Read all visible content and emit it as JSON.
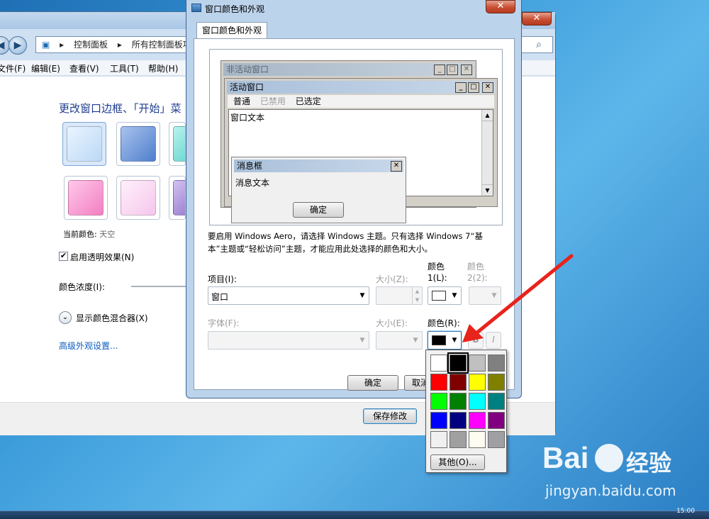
{
  "bg_window": {
    "address_path": [
      "控制面板",
      "所有控制面板项"
    ],
    "menu": [
      "文件(F)",
      "编辑(E)",
      "查看(V)",
      "工具(T)",
      "帮助(H)"
    ],
    "heading": "更改窗口边框、「开始」菜",
    "current_color_label": "当前颜色:",
    "current_color_value": "天空",
    "transparency_label": "启用透明效果(N)",
    "intensity_label": "颜色浓度(I):",
    "mixer_label": "显示颜色混合器(X)",
    "advanced_link": "高级外观设置...",
    "save_button": "保存修改",
    "swatch_colors": [
      "#bcd9f6",
      "#4f7fcc",
      "#57d2c8",
      "#f27fc2",
      "#f5c6ec",
      "#8c6bc8"
    ]
  },
  "dialog": {
    "title": "窗口颜色和外观",
    "close": "✕",
    "tab": "窗口颜色和外观",
    "preview": {
      "inactive_title": "非活动窗口",
      "active_title": "活动窗口",
      "menu_normal": "普通",
      "menu_disabled": "已禁用",
      "menu_selected": "已选定",
      "window_text": "窗口文本",
      "msgbox_title": "消息框",
      "msgbox_text": "消息文本",
      "msgbox_ok": "确定"
    },
    "info_line1": "要启用 Windows Aero，请选择 Windows 主题。只有选择 Windows 7“基",
    "info_line2": "本”主题或“轻松访问”主题，才能应用此处选择的颜色和大小。",
    "item_label": "项目(I):",
    "item_value": "窗口",
    "size_label": "大小(Z):",
    "color1_label_a": "颜色",
    "color1_label_b": "1(L):",
    "color2_label_a": "颜色",
    "color2_label_b": "2(2):",
    "font_label": "字体(F):",
    "font_size_label": "大小(E):",
    "font_color_label": "颜色(R):",
    "bold": "B",
    "italic": "I",
    "ok": "确定",
    "cancel": "取消"
  },
  "color_popup": {
    "colors": [
      "#ffffff",
      "#000000",
      "#c0c0c0",
      "#808080",
      "#ff0000",
      "#800000",
      "#ffff00",
      "#808000",
      "#00ff00",
      "#008000",
      "#00ffff",
      "#008080",
      "#0000ff",
      "#000080",
      "#ff00ff",
      "#800080",
      "#f0f0f0",
      "#a0a0a0",
      "#fffbf0",
      "#a0a0a4"
    ],
    "selected_index": 1,
    "other_button": "其他(O)..."
  },
  "watermark": {
    "brand": "Bai",
    "brand_cn": "经验",
    "url": "jingyan.baidu.com"
  },
  "taskbar": {
    "time": "15:00"
  }
}
